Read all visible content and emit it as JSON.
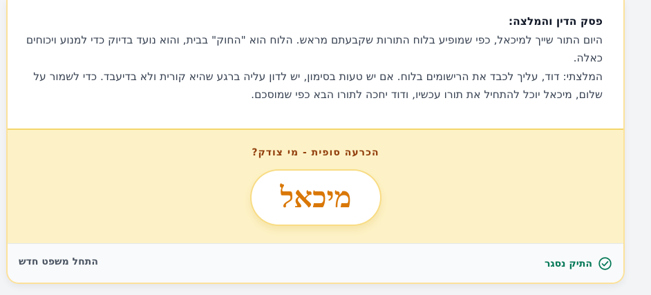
{
  "ruling": {
    "title": "פסק הדין והמלצה:",
    "paragraph1": "היום התור שייך למיכאל, כפי שמופיע בלוח התורות שקבעתם מראש. הלוח הוא \"החוק\" בבית, והוא נועד בדיוק כדי למנוע ויכוחים כאלה.",
    "paragraph2": "המלצתי: דוד, עליך לכבד את הרישומים בלוח. אם יש טעות בסימון, יש לדון עליה ברגע שהיא קורית ולא בדיעבד. כדי לשמור על שלום, מיכאל יוכל להתחיל את תורו עכשיו, ודוד יחכה לתורו הבא כפי שמוסכם."
  },
  "verdict": {
    "label": "הכרעה סופית - מי צודק?",
    "winner": "מיכאל"
  },
  "footer": {
    "status_label": "התיק נסגר",
    "status_icon": "check-circle-icon",
    "new_trial_label": "התחל משפט חדש"
  },
  "colors": {
    "accent": "#d97706",
    "verdict_bg": "#fdf2c7",
    "status_green": "#047857"
  }
}
